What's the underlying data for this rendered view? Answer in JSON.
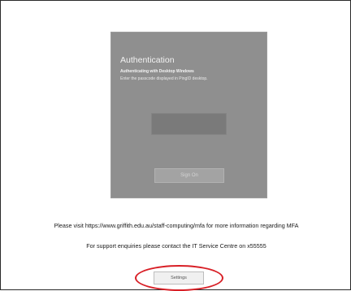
{
  "auth": {
    "title": "Authentication",
    "subtitle": "Authenticating with Desktop Windows",
    "instruction": "Enter the passcode displayed in PingID desktop.",
    "passcode_value": "",
    "sign_on_label": "Sign On"
  },
  "info": {
    "mfa_line": "Please visit https://www.griffith.edu.au/staff-computing/mfa for more information regarding MFA",
    "support_line": "For support enquiries please contact the IT Service Centre on x55555"
  },
  "settings_label": "Settings",
  "colors": {
    "card_bg": "#8f8f8f",
    "highlight": "#d81f26"
  }
}
